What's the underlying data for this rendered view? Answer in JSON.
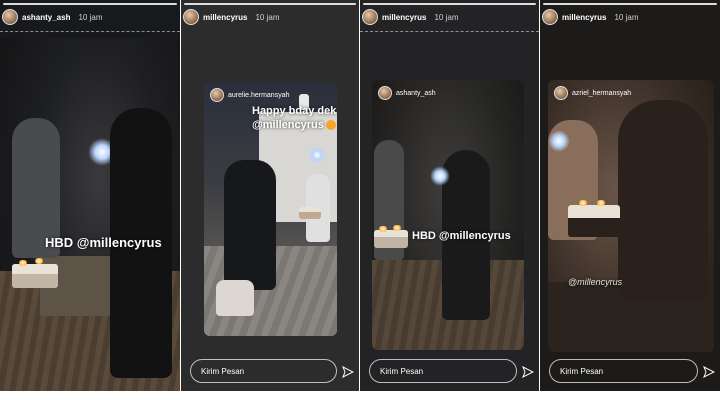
{
  "panels": [
    {
      "username": "ashanty_ash",
      "time": "10 jam",
      "overlay": "HBD @millencyrus"
    },
    {
      "username": "millencyrus",
      "time": "10 jam",
      "inner_user": "aurelie.hermansyah",
      "overlay_line1": "Happy bday dek",
      "overlay_line2": "@millencyrus",
      "message_placeholder": "Kirim Pesan"
    },
    {
      "username": "millencyrus",
      "time": "10 jam",
      "inner_user": "ashanty_ash",
      "overlay": "HBD @millencyrus",
      "message_placeholder": "Kirim Pesan"
    },
    {
      "username": "millencyrus",
      "time": "10 jam",
      "inner_user": "azriel_hermansyah",
      "overlay": "@millencyrus",
      "message_placeholder": "Kirim Pesan"
    }
  ],
  "colors": {
    "panel_bg": "#1d1d1f",
    "text": "#ffffff",
    "emoji": "#f5a623"
  },
  "icons": {
    "send": "send-icon",
    "avatar": "avatar"
  }
}
